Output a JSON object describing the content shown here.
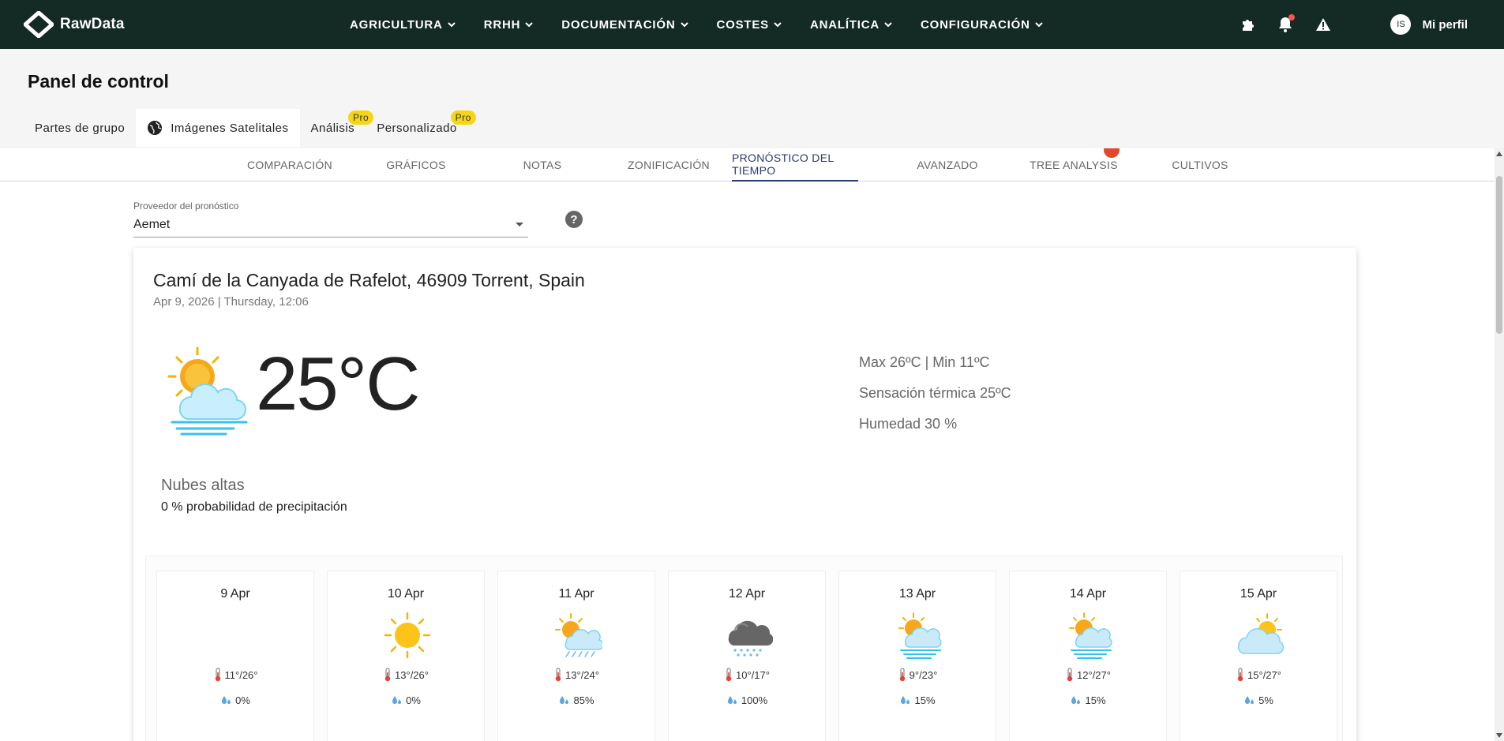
{
  "nav": {
    "brand": "RawData",
    "menu": [
      "AGRICULTURA",
      "RRHH",
      "DOCUMENTACIÓN",
      "COSTES",
      "ANALÍTICA",
      "CONFIGURACIÓN"
    ],
    "avatar_initials": "IS",
    "profile_label": "Mi perfil"
  },
  "page": {
    "title": "Panel de control",
    "tabs": [
      {
        "label": "Partes de grupo"
      },
      {
        "label": "Imágenes Satelitales"
      },
      {
        "label": "Análisis",
        "badge": "Pro"
      },
      {
        "label": "Personalizado",
        "badge": "Pro"
      }
    ]
  },
  "subtabs": [
    "COMPARACIÓN",
    "GRÁFICOS",
    "NOTAS",
    "ZONIFICACIÓN",
    "PRONÓSTICO DEL TIEMPO",
    "AVANZADO",
    "TREE ANALYSIS",
    "CULTIVOS"
  ],
  "provider": {
    "label": "Proveedor del pronóstico",
    "value": "Aemet",
    "help": "?"
  },
  "weather": {
    "address": "Camí de la Canyada de Rafelot, 46909 Torrent, Spain",
    "datetime": "Apr 9, 2026 | Thursday, 12:06",
    "temperature": "25°C",
    "maxmin": "Max 26ºC | Min 11ºC",
    "feels_like": "Sensación térmica 25ºC",
    "humidity": "Humedad 30 %",
    "condition": "Nubes altas",
    "precip_text": "0 % probabilidad de precipitación"
  },
  "forecast": [
    {
      "date": "9 Apr",
      "temp": "11°/26°",
      "rain": "0%",
      "icon": "none"
    },
    {
      "date": "10 Apr",
      "temp": "13°/26°",
      "rain": "0%",
      "icon": "sun-icon"
    },
    {
      "date": "11 Apr",
      "temp": "13°/24°",
      "rain": "85%",
      "icon": "sun-cloud-rain-icon"
    },
    {
      "date": "12 Apr",
      "temp": "10°/17°",
      "rain": "100%",
      "icon": "dark-cloud-rain-icon"
    },
    {
      "date": "13 Apr",
      "temp": "9°/23°",
      "rain": "15%",
      "icon": "sun-cloud-fog-icon"
    },
    {
      "date": "14 Apr",
      "temp": "12°/27°",
      "rain": "15%",
      "icon": "sun-cloud-fog-icon"
    },
    {
      "date": "15 Apr",
      "temp": "15°/27°",
      "rain": "5%",
      "icon": "partly-cloudy-icon"
    }
  ]
}
